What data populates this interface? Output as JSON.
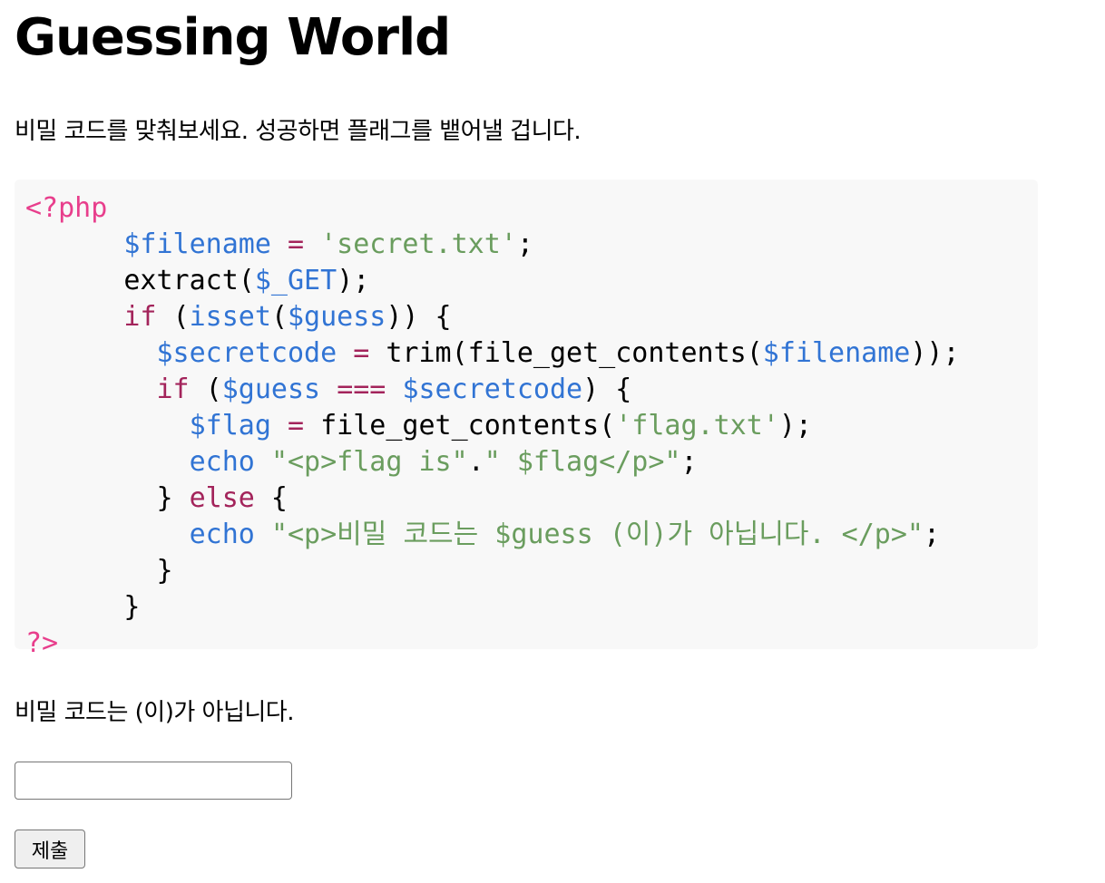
{
  "page": {
    "title": "Guessing World",
    "intro": "비밀 코드를 맞춰보세요. 성공하면 플래그를 뱉어낼 겁니다.",
    "result_message": "비밀 코드는 (이)가 아닙니다."
  },
  "code": {
    "lines": [
      [
        {
          "t": "<?php",
          "c": "tag"
        }
      ],
      [
        {
          "t": "      ",
          "c": "plain"
        },
        {
          "t": "$filename",
          "c": "var"
        },
        {
          "t": " ",
          "c": "plain"
        },
        {
          "t": "=",
          "c": "kw"
        },
        {
          "t": " ",
          "c": "plain"
        },
        {
          "t": "'secret.txt'",
          "c": "str"
        },
        {
          "t": ";",
          "c": "plain"
        }
      ],
      [
        {
          "t": "      extract(",
          "c": "plain"
        },
        {
          "t": "$_GET",
          "c": "var"
        },
        {
          "t": ");",
          "c": "plain"
        }
      ],
      [
        {
          "t": "      ",
          "c": "plain"
        },
        {
          "t": "if",
          "c": "kw"
        },
        {
          "t": " (",
          "c": "plain"
        },
        {
          "t": "isset",
          "c": "fn"
        },
        {
          "t": "(",
          "c": "plain"
        },
        {
          "t": "$guess",
          "c": "var"
        },
        {
          "t": ")) {",
          "c": "plain"
        }
      ],
      [
        {
          "t": "        ",
          "c": "plain"
        },
        {
          "t": "$secretcode",
          "c": "var"
        },
        {
          "t": " ",
          "c": "plain"
        },
        {
          "t": "=",
          "c": "kw"
        },
        {
          "t": " trim(file_get_contents(",
          "c": "plain"
        },
        {
          "t": "$filename",
          "c": "var"
        },
        {
          "t": "));",
          "c": "plain"
        }
      ],
      [
        {
          "t": "        ",
          "c": "plain"
        },
        {
          "t": "if",
          "c": "kw"
        },
        {
          "t": " (",
          "c": "plain"
        },
        {
          "t": "$guess",
          "c": "var"
        },
        {
          "t": " ",
          "c": "plain"
        },
        {
          "t": "===",
          "c": "kw"
        },
        {
          "t": " ",
          "c": "plain"
        },
        {
          "t": "$secretcode",
          "c": "var"
        },
        {
          "t": ") {",
          "c": "plain"
        }
      ],
      [
        {
          "t": "          ",
          "c": "plain"
        },
        {
          "t": "$flag",
          "c": "var"
        },
        {
          "t": " ",
          "c": "plain"
        },
        {
          "t": "=",
          "c": "kw"
        },
        {
          "t": " file_get_contents(",
          "c": "plain"
        },
        {
          "t": "'flag.txt'",
          "c": "str"
        },
        {
          "t": ");",
          "c": "plain"
        }
      ],
      [
        {
          "t": "          ",
          "c": "plain"
        },
        {
          "t": "echo",
          "c": "fn"
        },
        {
          "t": " ",
          "c": "plain"
        },
        {
          "t": "\"<p>flag is\"",
          "c": "str"
        },
        {
          "t": ".",
          "c": "plain"
        },
        {
          "t": "\" $flag</p>\"",
          "c": "str"
        },
        {
          "t": ";",
          "c": "plain"
        }
      ],
      [
        {
          "t": "        } ",
          "c": "plain"
        },
        {
          "t": "else",
          "c": "kw"
        },
        {
          "t": " {",
          "c": "plain"
        }
      ],
      [
        {
          "t": "          ",
          "c": "plain"
        },
        {
          "t": "echo",
          "c": "fn"
        },
        {
          "t": " ",
          "c": "plain"
        },
        {
          "t": "\"<p>비밀 코드는 $guess (이)가 아닙니다. </p>\"",
          "c": "str"
        },
        {
          "t": ";",
          "c": "plain"
        }
      ],
      [
        {
          "t": "        }",
          "c": "plain"
        }
      ],
      [
        {
          "t": "      }",
          "c": "plain"
        }
      ],
      [
        {
          "t": "?>",
          "c": "tag"
        }
      ]
    ]
  },
  "form": {
    "guess_value": "",
    "guess_placeholder": "",
    "submit_label": "제출"
  }
}
